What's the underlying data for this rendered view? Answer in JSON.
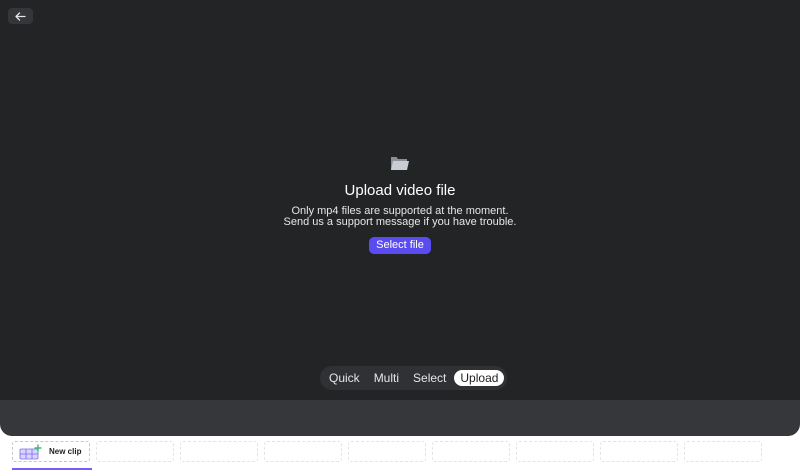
{
  "upload": {
    "title": "Upload video file",
    "desc_line1": "Only mp4 files are supported at the moment.",
    "desc_line2": "Send us a support message if you have trouble.",
    "select_label": "Select file"
  },
  "modes": {
    "quick": "Quick",
    "multi": "Multi",
    "select": "Select",
    "upload": "Upload",
    "active": "Upload"
  },
  "timeline": {
    "new_clip_label": "New clip"
  },
  "colors": {
    "stage_bg": "#232426",
    "accent": "#5b4cf2",
    "plus": "#3bbf6c"
  },
  "icons": {
    "back": "arrow-left-icon",
    "folder": "folder-icon",
    "new_clip": "clip-grid-plus-icon"
  }
}
